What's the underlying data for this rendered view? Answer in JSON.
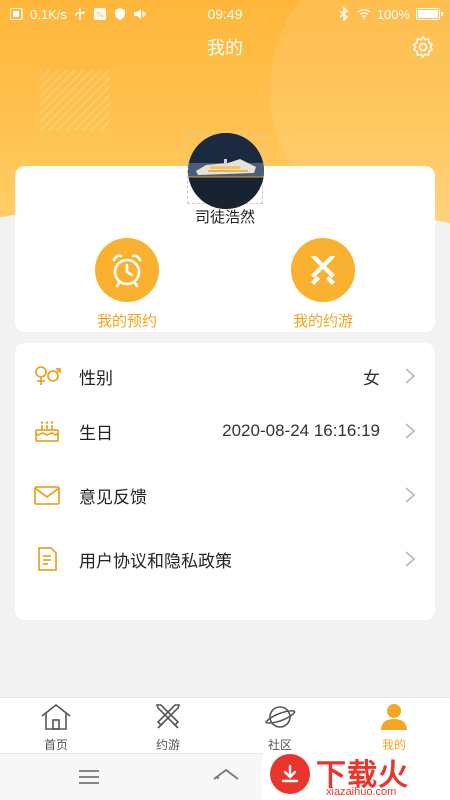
{
  "status_bar": {
    "speed": "0.1K/s",
    "time": "09:49",
    "battery": "100%",
    "battery_level": 1.0
  },
  "header": {
    "title": "我的",
    "settings_icon": "gear-icon"
  },
  "profile": {
    "username": "司徒浩然"
  },
  "quick_actions": [
    {
      "label": "我的预约",
      "icon": "alarm-clock-icon"
    },
    {
      "label": "我的约游",
      "icon": "crossed-swords-icon"
    }
  ],
  "settings_list": [
    {
      "label": "性别",
      "value": "女",
      "icon": "gender-icon"
    },
    {
      "label": "生日",
      "value": "2020-08-24 16:16:19",
      "icon": "birthday-cake-icon"
    },
    {
      "label": "意见反馈",
      "value": "",
      "icon": "envelope-icon"
    },
    {
      "label": "用户协议和隐私政策",
      "value": "",
      "icon": "document-icon"
    }
  ],
  "tabs": [
    {
      "label": "首页",
      "icon": "home-icon",
      "active": false
    },
    {
      "label": "约游",
      "icon": "crossed-swords-icon",
      "active": false
    },
    {
      "label": "社区",
      "icon": "planet-icon",
      "active": false
    },
    {
      "label": "我的",
      "icon": "person-icon",
      "active": true
    }
  ],
  "watermark": {
    "brand": "下载火",
    "url": "xiazaihuo.com"
  },
  "colors": {
    "accent": "#f9b12f",
    "accent_text": "#f3a51e",
    "watermark": "#e8362d"
  }
}
